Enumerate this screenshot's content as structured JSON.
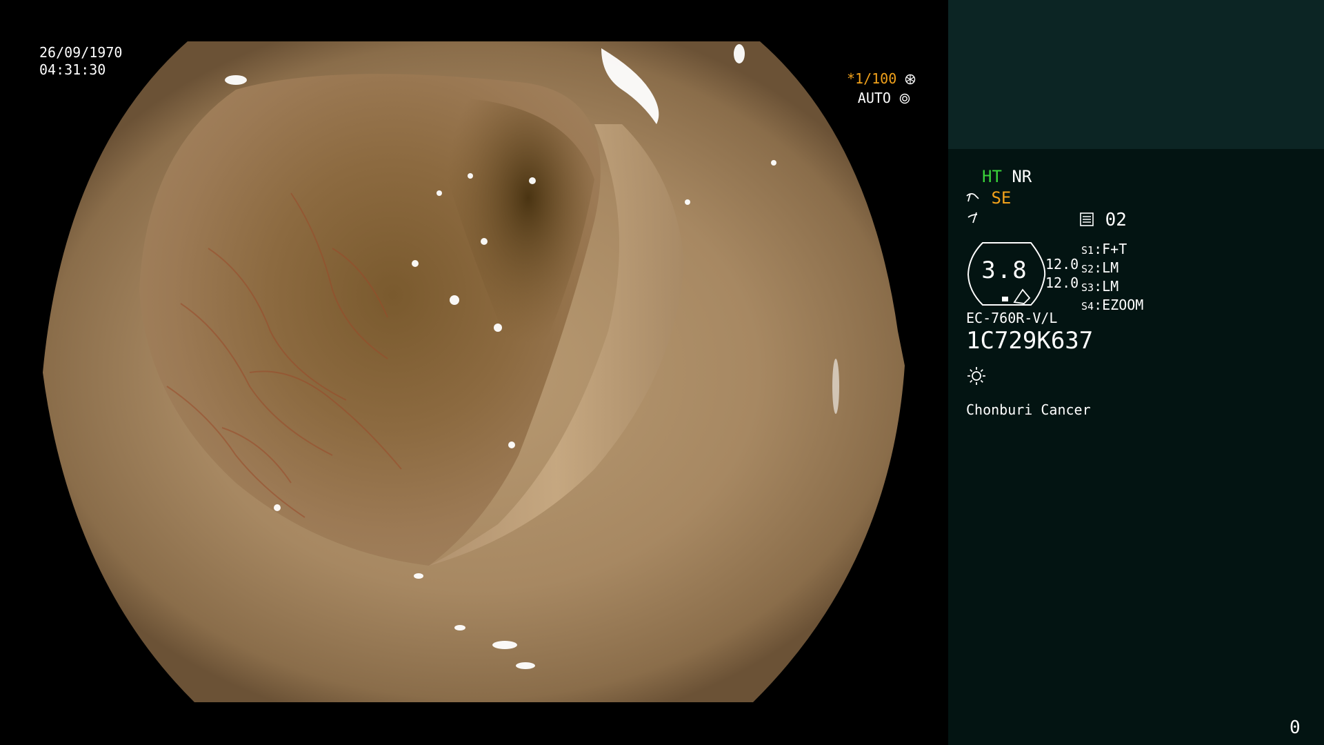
{
  "overlay": {
    "date": "26/09/1970",
    "time": "04:31:30",
    "shutter_star": "*",
    "shutter_value": "1/100",
    "shutter_icon": "aperture-icon",
    "iris_mode": "AUTO",
    "iris_icon": "iris-icon"
  },
  "panel": {
    "ht_label": "HT",
    "nr_label": "NR",
    "se_icon": "structure-enhance-icon",
    "se_label": "SE",
    "color_icon": "color-mode-icon",
    "memory_icon": "memory-card-icon",
    "memory_value": "02",
    "gauge_value": "3.8",
    "gauge_top": "12.0",
    "gauge_bottom": "12.0",
    "switches": [
      {
        "key": "S1",
        "value": "F+T"
      },
      {
        "key": "S2",
        "value": "LM"
      },
      {
        "key": "S3",
        "value": "LM"
      },
      {
        "key": "S4",
        "value": "EZOOM"
      }
    ],
    "scope_model": "EC-760R-V/L",
    "scope_serial": "1C729K637",
    "light_icon": "light-sun-icon",
    "hospital": "Chonburi Cancer",
    "counter": "0"
  },
  "colors": {
    "panel_bg": "#031412",
    "panel_top_bg": "#0c2524",
    "ht_green": "#3ad33a",
    "se_orange": "#f2a21b"
  }
}
